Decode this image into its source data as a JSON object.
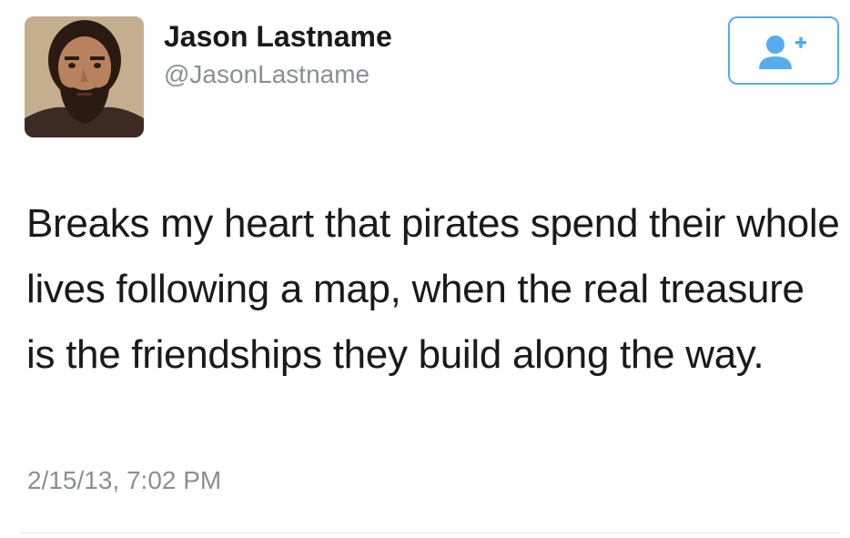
{
  "user": {
    "display_name": "Jason Lastname",
    "handle": "@JasonLastname"
  },
  "follow_button": {
    "icon": "add-user-icon"
  },
  "tweet": {
    "text": "Breaks my heart that pirates spend their whole lives following a map, when the real treasure is the friendships they build along the way.",
    "timestamp": "2/15/13, 7:02 PM"
  },
  "colors": {
    "accent": "#55acee",
    "muted_text": "#8a8f94",
    "text": "#1a1a1a"
  }
}
